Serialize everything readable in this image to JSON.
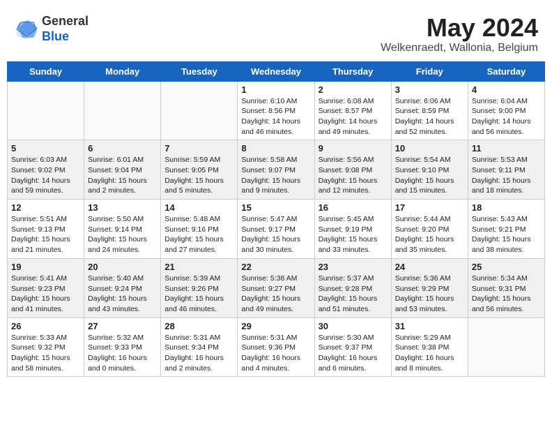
{
  "header": {
    "logo_general": "General",
    "logo_blue": "Blue",
    "month_year": "May 2024",
    "location": "Welkenraedt, Wallonia, Belgium"
  },
  "days_of_week": [
    "Sunday",
    "Monday",
    "Tuesday",
    "Wednesday",
    "Thursday",
    "Friday",
    "Saturday"
  ],
  "weeks": [
    {
      "shaded": false,
      "days": [
        {
          "num": "",
          "info": ""
        },
        {
          "num": "",
          "info": ""
        },
        {
          "num": "",
          "info": ""
        },
        {
          "num": "1",
          "info": "Sunrise: 6:10 AM\nSunset: 8:56 PM\nDaylight: 14 hours\nand 46 minutes."
        },
        {
          "num": "2",
          "info": "Sunrise: 6:08 AM\nSunset: 8:57 PM\nDaylight: 14 hours\nand 49 minutes."
        },
        {
          "num": "3",
          "info": "Sunrise: 6:06 AM\nSunset: 8:59 PM\nDaylight: 14 hours\nand 52 minutes."
        },
        {
          "num": "4",
          "info": "Sunrise: 6:04 AM\nSunset: 9:00 PM\nDaylight: 14 hours\nand 56 minutes."
        }
      ]
    },
    {
      "shaded": true,
      "days": [
        {
          "num": "5",
          "info": "Sunrise: 6:03 AM\nSunset: 9:02 PM\nDaylight: 14 hours\nand 59 minutes."
        },
        {
          "num": "6",
          "info": "Sunrise: 6:01 AM\nSunset: 9:04 PM\nDaylight: 15 hours\nand 2 minutes."
        },
        {
          "num": "7",
          "info": "Sunrise: 5:59 AM\nSunset: 9:05 PM\nDaylight: 15 hours\nand 5 minutes."
        },
        {
          "num": "8",
          "info": "Sunrise: 5:58 AM\nSunset: 9:07 PM\nDaylight: 15 hours\nand 9 minutes."
        },
        {
          "num": "9",
          "info": "Sunrise: 5:56 AM\nSunset: 9:08 PM\nDaylight: 15 hours\nand 12 minutes."
        },
        {
          "num": "10",
          "info": "Sunrise: 5:54 AM\nSunset: 9:10 PM\nDaylight: 15 hours\nand 15 minutes."
        },
        {
          "num": "11",
          "info": "Sunrise: 5:53 AM\nSunset: 9:11 PM\nDaylight: 15 hours\nand 18 minutes."
        }
      ]
    },
    {
      "shaded": false,
      "days": [
        {
          "num": "12",
          "info": "Sunrise: 5:51 AM\nSunset: 9:13 PM\nDaylight: 15 hours\nand 21 minutes."
        },
        {
          "num": "13",
          "info": "Sunrise: 5:50 AM\nSunset: 9:14 PM\nDaylight: 15 hours\nand 24 minutes."
        },
        {
          "num": "14",
          "info": "Sunrise: 5:48 AM\nSunset: 9:16 PM\nDaylight: 15 hours\nand 27 minutes."
        },
        {
          "num": "15",
          "info": "Sunrise: 5:47 AM\nSunset: 9:17 PM\nDaylight: 15 hours\nand 30 minutes."
        },
        {
          "num": "16",
          "info": "Sunrise: 5:45 AM\nSunset: 9:19 PM\nDaylight: 15 hours\nand 33 minutes."
        },
        {
          "num": "17",
          "info": "Sunrise: 5:44 AM\nSunset: 9:20 PM\nDaylight: 15 hours\nand 35 minutes."
        },
        {
          "num": "18",
          "info": "Sunrise: 5:43 AM\nSunset: 9:21 PM\nDaylight: 15 hours\nand 38 minutes."
        }
      ]
    },
    {
      "shaded": true,
      "days": [
        {
          "num": "19",
          "info": "Sunrise: 5:41 AM\nSunset: 9:23 PM\nDaylight: 15 hours\nand 41 minutes."
        },
        {
          "num": "20",
          "info": "Sunrise: 5:40 AM\nSunset: 9:24 PM\nDaylight: 15 hours\nand 43 minutes."
        },
        {
          "num": "21",
          "info": "Sunrise: 5:39 AM\nSunset: 9:26 PM\nDaylight: 15 hours\nand 46 minutes."
        },
        {
          "num": "22",
          "info": "Sunrise: 5:38 AM\nSunset: 9:27 PM\nDaylight: 15 hours\nand 49 minutes."
        },
        {
          "num": "23",
          "info": "Sunrise: 5:37 AM\nSunset: 9:28 PM\nDaylight: 15 hours\nand 51 minutes."
        },
        {
          "num": "24",
          "info": "Sunrise: 5:36 AM\nSunset: 9:29 PM\nDaylight: 15 hours\nand 53 minutes."
        },
        {
          "num": "25",
          "info": "Sunrise: 5:34 AM\nSunset: 9:31 PM\nDaylight: 15 hours\nand 56 minutes."
        }
      ]
    },
    {
      "shaded": false,
      "days": [
        {
          "num": "26",
          "info": "Sunrise: 5:33 AM\nSunset: 9:32 PM\nDaylight: 15 hours\nand 58 minutes."
        },
        {
          "num": "27",
          "info": "Sunrise: 5:32 AM\nSunset: 9:33 PM\nDaylight: 16 hours\nand 0 minutes."
        },
        {
          "num": "28",
          "info": "Sunrise: 5:31 AM\nSunset: 9:34 PM\nDaylight: 16 hours\nand 2 minutes."
        },
        {
          "num": "29",
          "info": "Sunrise: 5:31 AM\nSunset: 9:36 PM\nDaylight: 16 hours\nand 4 minutes."
        },
        {
          "num": "30",
          "info": "Sunrise: 5:30 AM\nSunset: 9:37 PM\nDaylight: 16 hours\nand 6 minutes."
        },
        {
          "num": "31",
          "info": "Sunrise: 5:29 AM\nSunset: 9:38 PM\nDaylight: 16 hours\nand 8 minutes."
        },
        {
          "num": "",
          "info": ""
        }
      ]
    }
  ]
}
